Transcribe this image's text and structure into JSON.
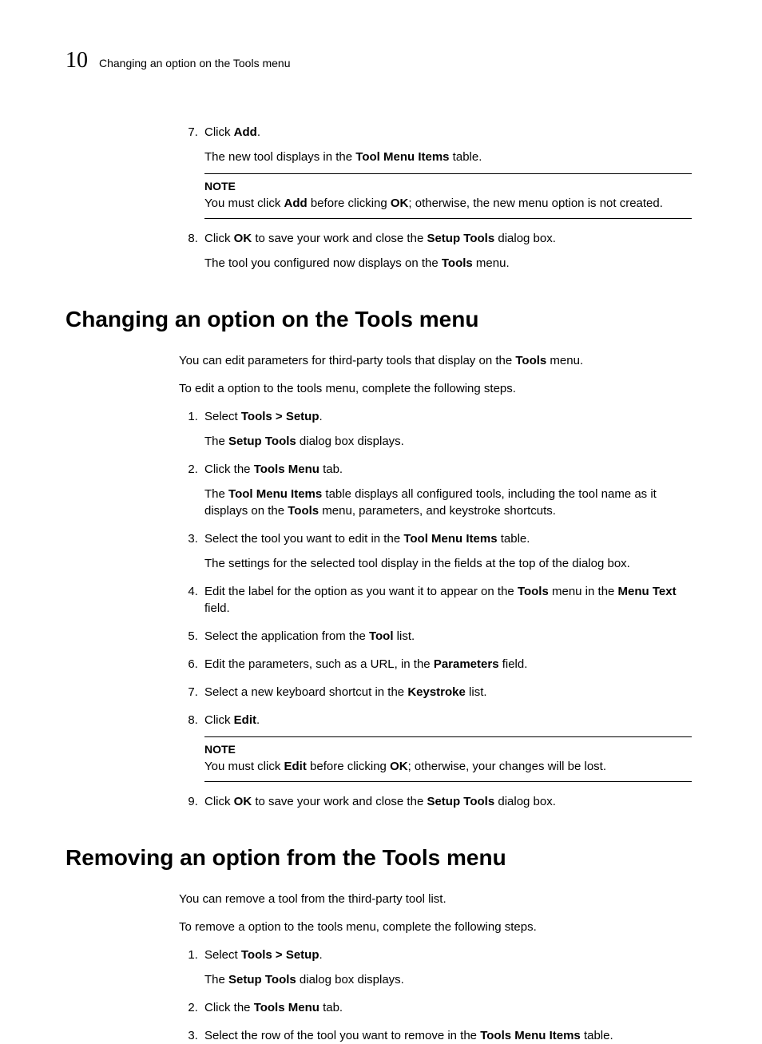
{
  "header": {
    "chapter_number": "10",
    "chapter_title": "Changing an option on the Tools menu"
  },
  "top_steps": {
    "start": 7,
    "items": [
      {
        "main_before": "Click ",
        "main_bold": "Add",
        "main_after": ".",
        "sub_before": "The new tool displays in the ",
        "sub_bold": "Tool Menu Items",
        "sub_after": " table.",
        "note_label": "NOTE",
        "note_before": "You must click ",
        "note_bold1": "Add",
        "note_mid": " before clicking ",
        "note_bold2": "OK",
        "note_after": "; otherwise, the new menu option is not created."
      },
      {
        "main_before": "Click ",
        "main_bold": "OK",
        "main_after": " to save your work and close the ",
        "main_bold2": "Setup Tools",
        "main_after2": " dialog box.",
        "sub_before": "The tool you configured now displays on the ",
        "sub_bold": "Tools",
        "sub_after": " menu."
      }
    ]
  },
  "section1": {
    "title": "Changing an option on the Tools menu",
    "intro1_before": "You can edit parameters for third-party tools that display on the ",
    "intro1_bold": "Tools",
    "intro1_after": " menu.",
    "intro2": "To edit a option to the tools menu, complete the following steps.",
    "steps": [
      {
        "main_before": "Select ",
        "main_bold": "Tools > Setup",
        "main_after": ".",
        "sub_before": "The ",
        "sub_bold": "Setup Tools",
        "sub_after": " dialog box displays."
      },
      {
        "main_before": "Click the ",
        "main_bold": "Tools Menu",
        "main_after": " tab.",
        "sub_before": "The ",
        "sub_bold": "Tool Menu Items",
        "sub_mid": " table displays all configured tools, including the tool name as it displays on the ",
        "sub_bold2": "Tools",
        "sub_after": " menu, parameters, and keystroke shortcuts."
      },
      {
        "main_before": "Select the tool you want to edit in the ",
        "main_bold": "Tool Menu Items",
        "main_after": " table.",
        "sub": "The settings for the selected tool display in the fields at the top of the dialog box."
      },
      {
        "main_before": "Edit the label for the option as you want it to appear on the ",
        "main_bold": "Tools",
        "main_mid": " menu in the ",
        "main_bold2": "Menu Text",
        "main_after": " field."
      },
      {
        "main_before": "Select the application from the ",
        "main_bold": "Tool",
        "main_after": " list."
      },
      {
        "main_before": "Edit the parameters, such as a URL, in the ",
        "main_bold": "Parameters",
        "main_after": " field."
      },
      {
        "main_before": "Select a new keyboard shortcut in the ",
        "main_bold": "Keystroke",
        "main_after": " list."
      },
      {
        "main_before": "Click ",
        "main_bold": "Edit",
        "main_after": ".",
        "note_label": "NOTE",
        "note_before": "You must click ",
        "note_bold1": "Edit",
        "note_mid": " before clicking ",
        "note_bold2": "OK",
        "note_after": "; otherwise, your changes will be lost."
      },
      {
        "main_before": "Click ",
        "main_bold": "OK",
        "main_mid": " to save your work and close the ",
        "main_bold2": "Setup Tools",
        "main_after": " dialog box."
      }
    ]
  },
  "section2": {
    "title": "Removing an option from the Tools menu",
    "intro1": "You can remove a tool from the third-party tool list.",
    "intro2": "To remove a option to the tools menu, complete the following steps.",
    "steps": [
      {
        "main_before": "Select ",
        "main_bold": "Tools > Setup",
        "main_after": ".",
        "sub_before": "The ",
        "sub_bold": "Setup Tools",
        "sub_after": " dialog box displays."
      },
      {
        "main_before": "Click the ",
        "main_bold": "Tools Menu",
        "main_after": " tab."
      },
      {
        "main_before": "Select the row of the tool you want to remove in the ",
        "main_bold": "Tools Menu Items",
        "main_after": " table."
      }
    ]
  }
}
